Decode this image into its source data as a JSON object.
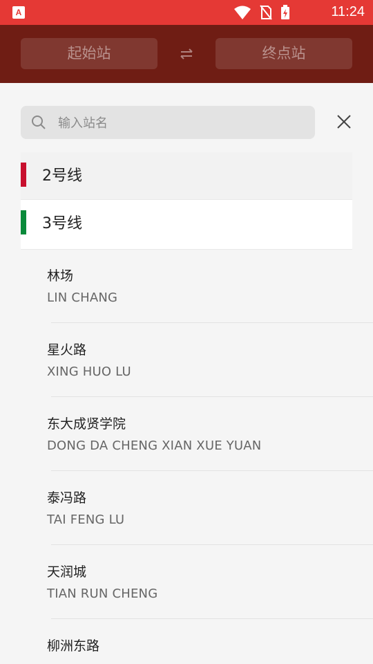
{
  "status_bar": {
    "time": "11:24",
    "app_icon_letter": "A"
  },
  "header": {
    "start_station_label": "起始站",
    "end_station_label": "终点站"
  },
  "search": {
    "placeholder": "输入站名"
  },
  "lines": [
    {
      "label": "2号线",
      "color": "#c8102e",
      "selected": false
    },
    {
      "label": "3号线",
      "color": "#0a8a3a",
      "selected": true
    }
  ],
  "stations": [
    {
      "name": "林场",
      "pinyin": "LIN CHANG"
    },
    {
      "name": "星火路",
      "pinyin": "XING HUO LU"
    },
    {
      "name": "东大成贤学院",
      "pinyin": "DONG DA CHENG XIAN XUE YUAN"
    },
    {
      "name": "泰冯路",
      "pinyin": "TAI FENG LU"
    },
    {
      "name": "天润城",
      "pinyin": "TIAN RUN CHENG"
    },
    {
      "name": "柳洲东路",
      "pinyin": ""
    }
  ]
}
